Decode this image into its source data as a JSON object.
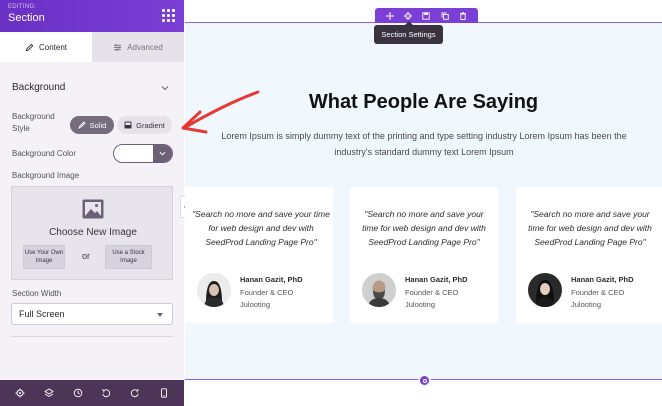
{
  "sidebar": {
    "editing_label": "EDITING:",
    "title": "Section",
    "tabs": [
      {
        "label": "Content",
        "icon": "pencil-icon",
        "active": true
      },
      {
        "label": "Advanced",
        "icon": "sliders-icon",
        "active": false
      }
    ],
    "section_heading": "Background",
    "background_style_label": "Background Style",
    "style_buttons": {
      "solid": "Solid",
      "gradient": "Gradient"
    },
    "background_color_label": "Background Color",
    "background_image_label": "Background Image",
    "choose_image": "Choose New Image",
    "own_image_button": "Use Your Own Image",
    "stock_image_button": "Use a Stock Image",
    "or_text": "or",
    "section_width_label": "Section Width",
    "section_width_value": "Full Screen",
    "footer_icons": [
      "gear-icon",
      "layers-icon",
      "history-icon",
      "undo-icon",
      "redo-icon",
      "mobile-preview-icon"
    ]
  },
  "canvas": {
    "toolbar_icons": [
      "move-icon",
      "settings-icon",
      "save-icon",
      "copy-icon",
      "delete-icon"
    ],
    "tooltip": "Section Settings",
    "heading": "What People Are Saying",
    "subtext": "Lorem Ipsum is simply dummy text of the printing and type setting industry Lorem Ipsum has been the industry's standard dummy text Lorem Ipsum",
    "testimonials": [
      {
        "quote": "\"Search no more and save your time for web design and dev with SeedProd Landing Page Pro\"",
        "name": "Hanan Gazit, PhD",
        "role": "Founder & CEO",
        "company": "Julooting"
      },
      {
        "quote": "\"Search no more and save your time for web design and dev with SeedProd Landing Page Pro\"",
        "name": "Hanan Gazit, PhD",
        "role": "Founder & CEO",
        "company": "Julooting"
      },
      {
        "quote": "\"Search no more and save your time for web design and dev with SeedProd Landing Page Pro\"",
        "name": "Hanan Gazit, PhD",
        "role": "Founder & CEO",
        "company": "Julooting"
      }
    ]
  },
  "colors": {
    "accent": "#7b3fd6",
    "sidebar_footer": "#4d3557",
    "section_bg": "#f0f7fd",
    "annotation_arrow": "#e53935"
  }
}
